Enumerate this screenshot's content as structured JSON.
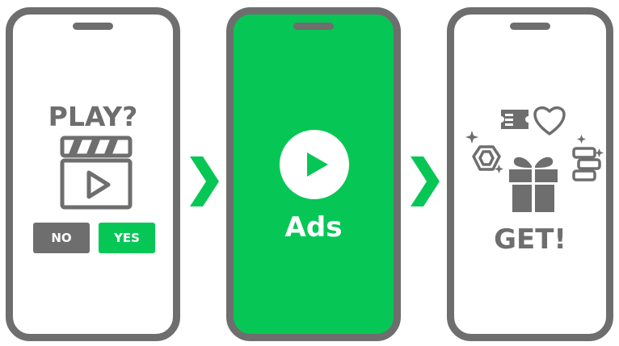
{
  "steps": [
    {
      "title": "PLAY?",
      "buttons": {
        "no_label": "NO",
        "yes_label": "YES"
      },
      "icon": "video-clapper-icon"
    },
    {
      "label": "Ads",
      "icon": "play-circle-icon"
    },
    {
      "label": "GET!",
      "icons": [
        "ticket-icon",
        "heart-icon",
        "gem-icon",
        "gift-icon",
        "stacked-coins-icon",
        "sparkle-icon"
      ]
    }
  ],
  "separator_icon": "chevron-right-icon",
  "colors": {
    "frame": "#6e6e6e",
    "accent_green": "#06c755",
    "background": "#ffffff"
  }
}
